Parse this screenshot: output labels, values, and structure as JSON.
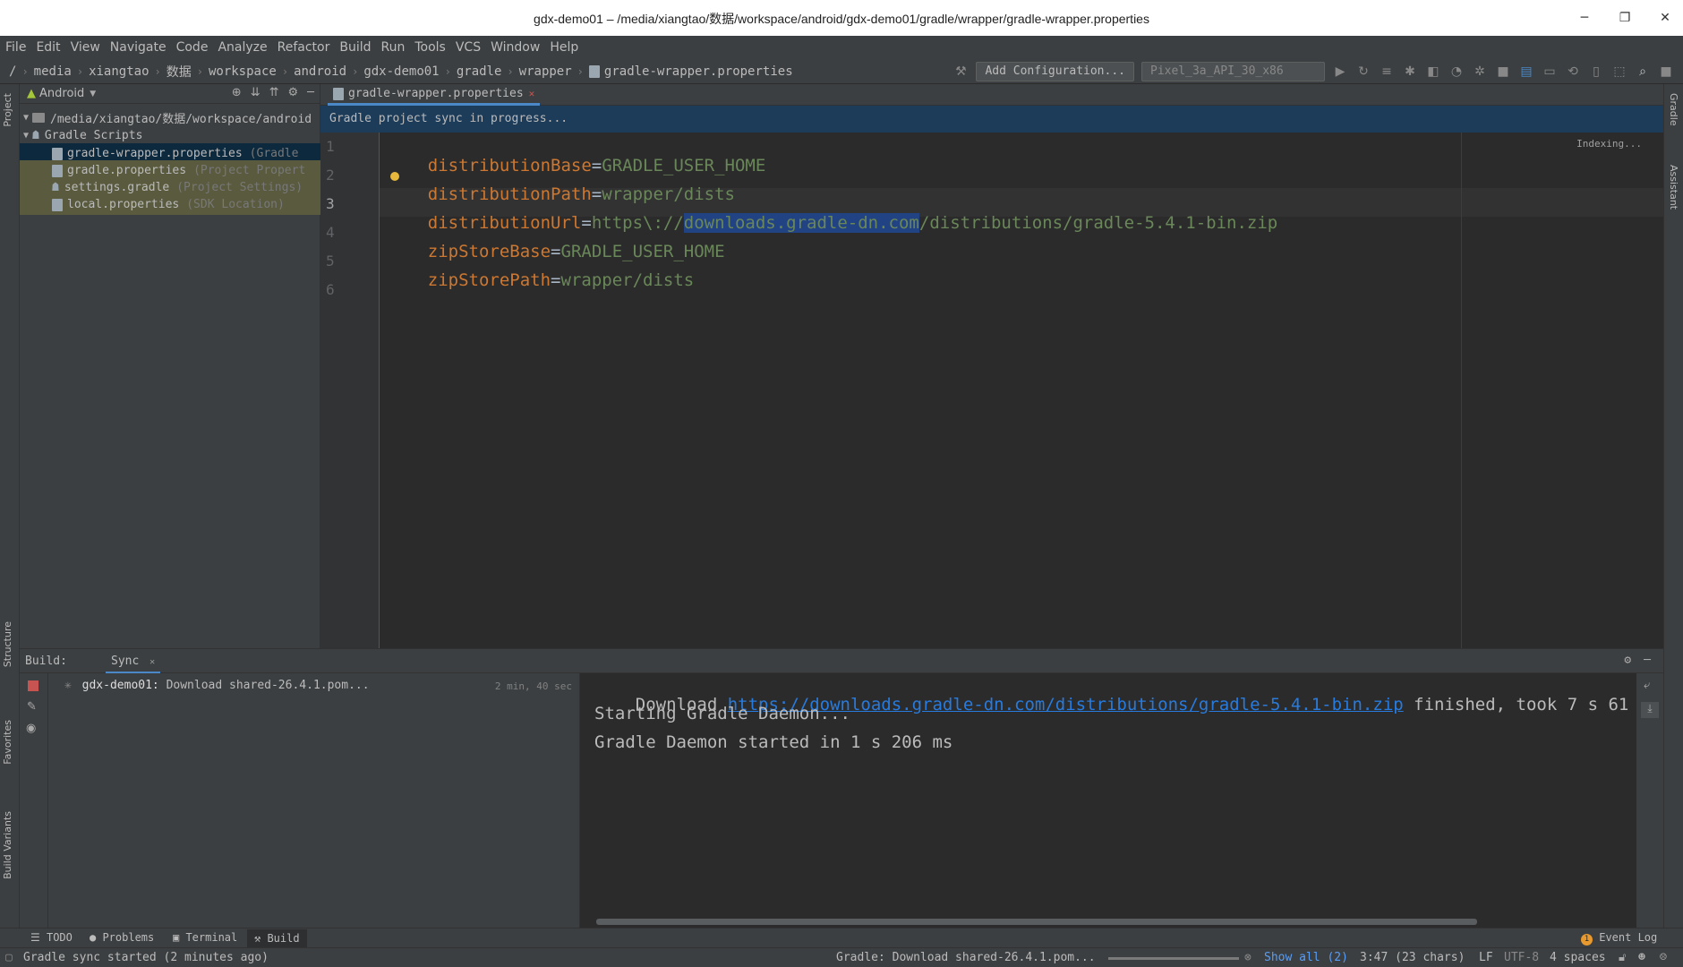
{
  "window": {
    "title": "gdx-demo01 – /media/xiangtao/数据/workspace/android/gdx-demo01/gradle/wrapper/gradle-wrapper.properties",
    "minimize": "─",
    "maximize": "❐",
    "close": "✕"
  },
  "menu": [
    "File",
    "Edit",
    "View",
    "Navigate",
    "Code",
    "Analyze",
    "Refactor",
    "Build",
    "Run",
    "Tools",
    "VCS",
    "Window",
    "Help"
  ],
  "breadcrumbs": [
    "/",
    "media",
    "xiangtao",
    "数据",
    "workspace",
    "android",
    "gdx-demo01",
    "gradle",
    "wrapper",
    "gradle-wrapper.properties"
  ],
  "toolbar": {
    "add_configuration": "Add Configuration...",
    "device": "Pixel_3a_API_30_x86"
  },
  "left_strip": {
    "project": "Project",
    "structure": "Structure",
    "favorites": "Favorites",
    "build_variants": "Build Variants"
  },
  "right_strip": {
    "gradle": "Gradle",
    "assistant": "Assistant"
  },
  "project_panel": {
    "view_mode": "Android",
    "root_path": "/media/xiangtao/数据/workspace/android",
    "gradle_scripts": "Gradle Scripts",
    "files": [
      {
        "name": "gradle-wrapper.properties",
        "hint": "(Gradle"
      },
      {
        "name": "gradle.properties",
        "hint": "(Project Propert"
      },
      {
        "name": "settings.gradle",
        "hint": "(Project Settings)"
      },
      {
        "name": "local.properties",
        "hint": "(SDK Location)"
      }
    ]
  },
  "editor": {
    "tab": "gradle-wrapper.properties",
    "banner": "Gradle project sync in progress...",
    "indexing": "Indexing...",
    "line_numbers": [
      "1",
      "2",
      "3",
      "4",
      "5",
      "6"
    ],
    "lines": [
      {
        "key": "distributionBase",
        "eq": "=",
        "value": "GRADLE_USER_HOME"
      },
      {
        "key": "distributionPath",
        "eq": "=",
        "value": "wrapper/dists"
      },
      {
        "key": "distributionUrl",
        "eq": "=",
        "value_pre": "https\\://",
        "value_sel": "downloads.gradle-dn.com",
        "value_post": "/distributions/gradle-5.4.1-bin.zip"
      },
      {
        "key": "zipStoreBase",
        "eq": "=",
        "value": "GRADLE_USER_HOME"
      },
      {
        "key": "zipStorePath",
        "eq": "=",
        "value": "wrapper/dists"
      }
    ]
  },
  "build": {
    "label": "Build:",
    "tab": "Sync",
    "task_name": "gdx-demo01:",
    "task_status": "Download shared-26.4.1.pom...",
    "task_time": "2 min, 40 sec",
    "console": {
      "line1_pre": "Download ",
      "line1_link": "https://downloads.gradle-dn.com/distributions/gradle-5.4.1-bin.zip",
      "line1_post": " finished, took 7 s 61",
      "line2": "Starting Gradle Daemon...",
      "line3": "Gradle Daemon started in 1 s 206 ms"
    }
  },
  "bottom_tabs": {
    "todo": "TODO",
    "problems": "Problems",
    "terminal": "Terminal",
    "build": "Build",
    "event_log": "Event Log",
    "event_count": "1"
  },
  "status": {
    "left": "Gradle sync started (2 minutes ago)",
    "task": "Gradle: Download shared-26.4.1.pom...",
    "show_all": "Show all (2)",
    "position": "3:47 (23 chars)",
    "line_sep": "LF",
    "encoding": "UTF-8",
    "indent": "4 spaces"
  },
  "colors": {
    "keyword": "#cc7832",
    "value": "#6a8759",
    "link": "#287bde",
    "selection": "#214283"
  }
}
